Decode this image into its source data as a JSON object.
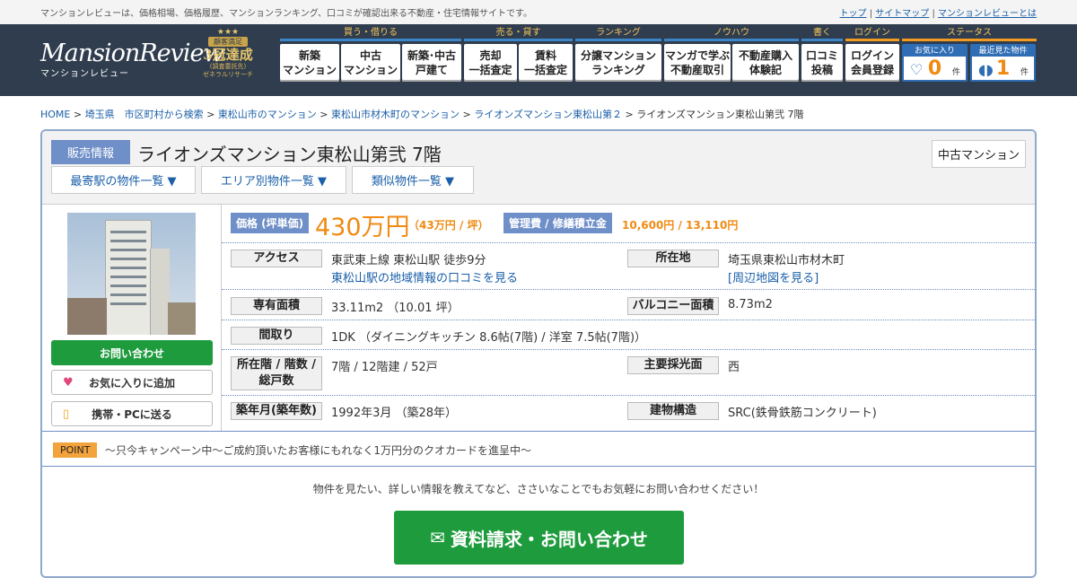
{
  "topbar": {
    "tagline": "マンションレビューは、価格相場、価格履歴、マンションランキング、口コミが確認出来る不動産・住宅情報サイトです。",
    "links": [
      "トップ",
      "サイトマップ",
      "マンションレビューとは"
    ]
  },
  "logo": {
    "en": "MansionReview",
    "jp": "マンションレビュー"
  },
  "badge": {
    "stars": "★★★",
    "line1": "顧客満足",
    "line2": "3冠達成",
    "line3": "(調査委託先)",
    "line4": "ゼネラルリサーチ"
  },
  "nav": [
    {
      "group": "買う・借りる",
      "items": [
        "新築\nマンション",
        "中古\nマンション",
        "新築･中古\n戸建て"
      ]
    },
    {
      "group": "売る・貸す",
      "items": [
        "売却\n一括査定",
        "賃料\n一括査定"
      ]
    },
    {
      "group": "ランキング",
      "items": [
        "分譲マンション\nランキング"
      ]
    },
    {
      "group": "ノウハウ",
      "items": [
        "マンガで学ぶ\n不動産取引",
        "不動産購入\n体験記"
      ]
    },
    {
      "group": "書く",
      "items": [
        "口コミ\n投稿"
      ]
    },
    {
      "group": "ログイン",
      "items": [
        "ログイン\n会員登録"
      ]
    }
  ],
  "status": {
    "group": "ステータス",
    "favorites": {
      "label": "お気に入り",
      "count": "0",
      "unit": "件"
    },
    "recent": {
      "label": "最近見た物件",
      "count": "1",
      "unit": "件"
    }
  },
  "breadcrumb": [
    "HOME",
    "埼玉県　市区町村から検索",
    "東松山市のマンション",
    "東松山市材木町のマンション",
    "ライオンズマンション東松山第２",
    "ライオンズマンション東松山第弐 7階"
  ],
  "listing": {
    "sale_label": "販売情報",
    "title": "ライオンズマンション東松山第弐 7階",
    "type": "中古マンション",
    "dropdowns": [
      "最寄駅の物件一覧 ▼",
      "エリア別物件一覧 ▼",
      "類似物件一覧 ▼"
    ],
    "buttons": {
      "inquiry": "お問い合わせ",
      "favorite": "お気に入りに追加",
      "send": "携帯・PCに送る"
    },
    "price_label": "価格 (坪単価)",
    "price": "430万円",
    "price_per_tsubo": "（43万円 / 坪）",
    "mgmt_label": "管理費 / 修繕積立金",
    "mgmt_value": "10,600円 / 13,110円",
    "access_label": "アクセス",
    "access_value": "東武東上線 東松山駅 徒歩9分",
    "access_link": "東松山駅の地域情報の口コミを見る",
    "address_label": "所在地",
    "address_value": "埼玉県東松山市材木町",
    "map_link": "[周辺地図を見る]",
    "area_label": "専有面積",
    "area_value": "33.11m2 （10.01 坪）",
    "balcony_label": "バルコニー面積",
    "balcony_value": "8.73m2",
    "layout_label": "間取り",
    "layout_value": "1DK （ダイニングキッチン 8.6帖(7階) / 洋室 7.5帖(7階)）",
    "floor_label": "所在階 / 階数 / 総戸数",
    "floor_value": "7階 / 12階建 / 52戸",
    "light_label": "主要採光面",
    "light_value": "西",
    "built_label": "築年月(築年数)",
    "built_value": "1992年3月 （築28年）",
    "structure_label": "建物構造",
    "structure_value": "SRC(鉄骨鉄筋コンクリート)",
    "point_label": "POINT",
    "point_text": "～只今キャンペーン中～ご成約頂いたお客様にもれなく1万円分のクオカードを進呈中～",
    "inquiry_text": "物件を見たい、詳しい情報を教えてなど、ささいなことでもお気軽にお問い合わせください！",
    "big_button": "資料請求・お問い合わせ"
  }
}
